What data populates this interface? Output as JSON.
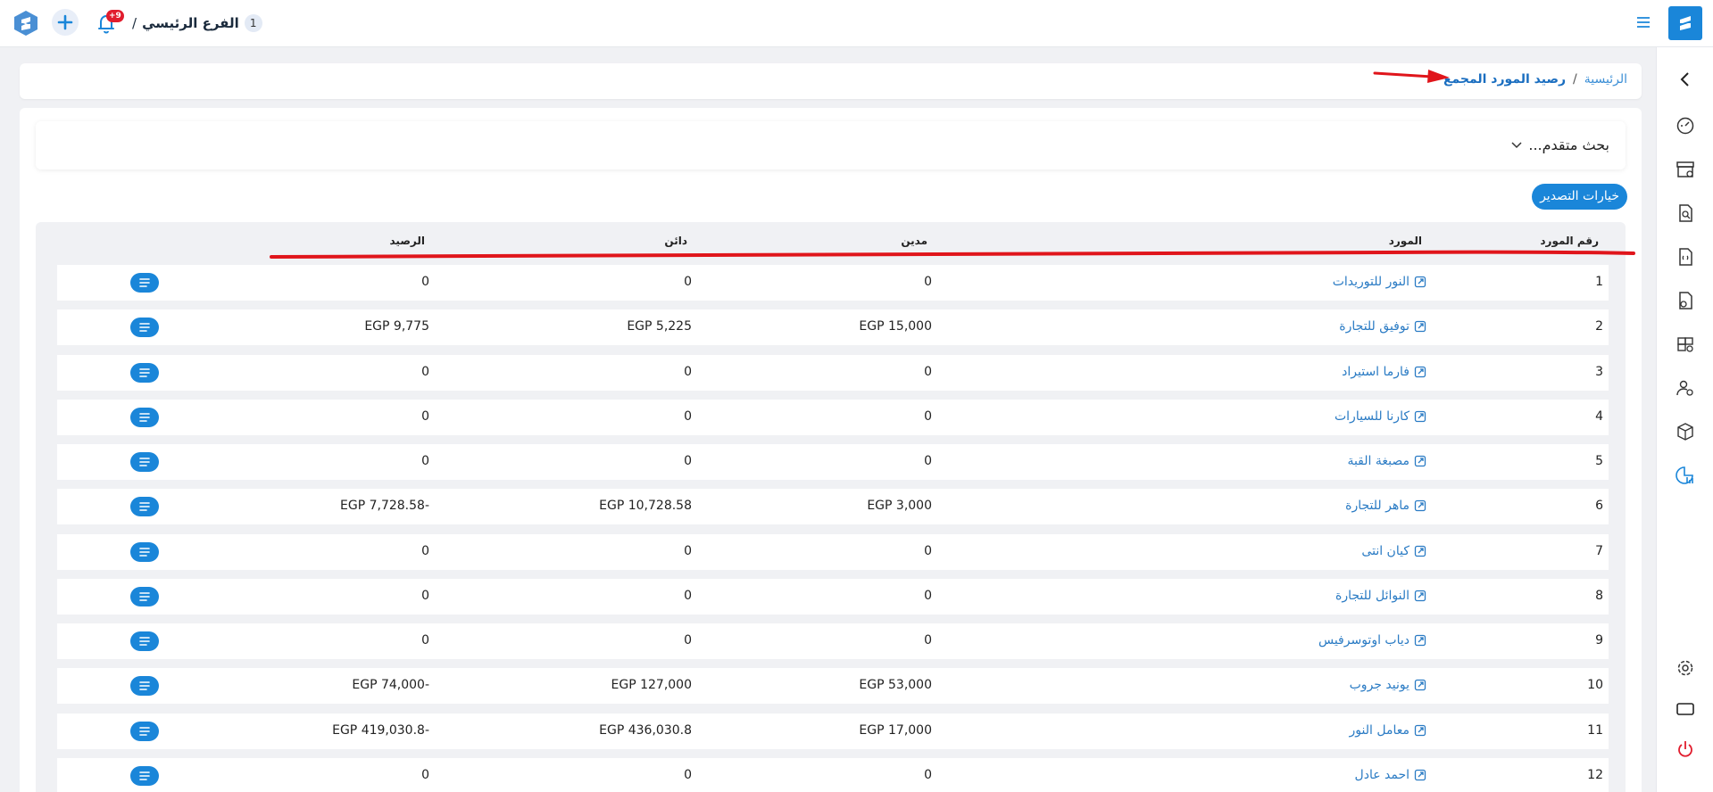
{
  "topbar": {
    "branch_number": "1",
    "branch_name": "الفرع الرئيسي",
    "branch_separator": "/",
    "notification_count": "+9"
  },
  "breadcrumb": {
    "home": "الرئيسية",
    "separator": "/",
    "current": "رصيد المورد المجمع"
  },
  "search": {
    "title": "بحث متقدم..."
  },
  "export": {
    "label": "خيارات التصدير"
  },
  "table": {
    "headers": {
      "supplier_no": "رقم المورد",
      "supplier": "المورد",
      "debit": "مدين",
      "credit": "دائن",
      "balance": "الرصيد"
    },
    "rows": [
      {
        "no": "1",
        "name": "النور للتوريدات",
        "debit": "0",
        "credit": "0",
        "balance": "0"
      },
      {
        "no": "2",
        "name": "توفيق للتجارة",
        "debit": "EGP 15,000",
        "credit": "EGP 5,225",
        "balance": "EGP 9,775"
      },
      {
        "no": "3",
        "name": "فارما استيراد",
        "debit": "0",
        "credit": "0",
        "balance": "0"
      },
      {
        "no": "4",
        "name": "كارنا للسيارات",
        "debit": "0",
        "credit": "0",
        "balance": "0"
      },
      {
        "no": "5",
        "name": "مصبغة القبة",
        "debit": "0",
        "credit": "0",
        "balance": "0"
      },
      {
        "no": "6",
        "name": "ماهر للتجارة",
        "debit": "EGP 3,000",
        "credit": "EGP 10,728.58",
        "balance": "EGP 7,728.58-"
      },
      {
        "no": "7",
        "name": "كيان انتى",
        "debit": "0",
        "credit": "0",
        "balance": "0"
      },
      {
        "no": "8",
        "name": "النوائل للتجارة",
        "debit": "0",
        "credit": "0",
        "balance": "0"
      },
      {
        "no": "9",
        "name": "دياب اوتوسرفيس",
        "debit": "0",
        "credit": "0",
        "balance": "0"
      },
      {
        "no": "10",
        "name": "يونيد جروب",
        "debit": "EGP 53,000",
        "credit": "EGP 127,000",
        "balance": "EGP 74,000-"
      },
      {
        "no": "11",
        "name": "معامل النور",
        "debit": "EGP 17,000",
        "credit": "EGP 436,030.8",
        "balance": "EGP 419,030.8-"
      },
      {
        "no": "12",
        "name": "احمد عادل",
        "debit": "0",
        "credit": "0",
        "balance": "0"
      }
    ]
  },
  "sidebar": {
    "icons": [
      "chevron-left-icon",
      "dashboard-icon",
      "store-icon",
      "search-document-icon",
      "invoice-icon",
      "document-settings-icon",
      "boxes-icon",
      "users-settings-icon",
      "package-icon",
      "reports-chart-icon",
      "settings-icon",
      "screen-icon",
      "power-icon"
    ]
  },
  "colors": {
    "accent": "#1a86d9",
    "annotation": "#e0151b",
    "danger": "#e11d2e"
  }
}
